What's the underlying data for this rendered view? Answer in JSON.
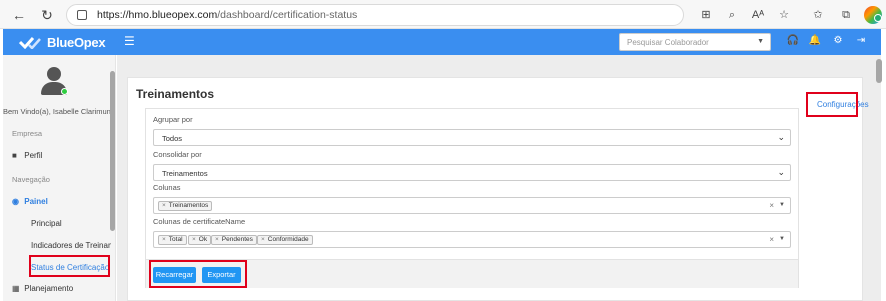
{
  "browser": {
    "url_domain": "https://hmo.blueopex.com",
    "url_path": "/dashboard/certification-status"
  },
  "app": {
    "brand": "BlueOpex",
    "search_placeholder": "Pesquisar Colaborador"
  },
  "sidebar": {
    "welcome": "Bem Vindo(a), Isabelle Clarimundo",
    "section_company": "Empresa",
    "item_profile": "Perfil",
    "section_navigation": "Navegação",
    "item_panel": "Painel",
    "sub_items": [
      "Principal",
      "Indicadores de Treinam",
      "Status de Certificação"
    ],
    "item_planning": "Planejamento"
  },
  "main": {
    "title": "Treinamentos",
    "config_link": "Configurações",
    "group_by_label": "Agrupar por",
    "group_by_value": "Todos",
    "consolidate_label": "Consolidar por",
    "consolidate_value": "Treinamentos",
    "columns_label": "Colunas",
    "columns_tags": [
      "Treinamentos"
    ],
    "cert_columns_label": "Colunas de certificateName",
    "cert_columns_tags": [
      "Total",
      "Ok",
      "Pendentes",
      "Conformidade"
    ],
    "reload_button": "Recarregar",
    "export_button": "Exportar"
  },
  "colors": {
    "navbar": "#3a8ef0",
    "accent": "#2f7fe0",
    "button": "#2196f3",
    "highlight": "#e0001b"
  }
}
